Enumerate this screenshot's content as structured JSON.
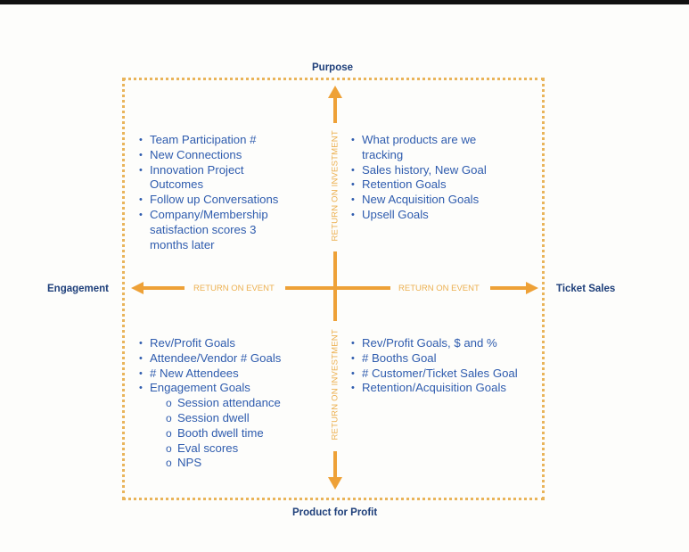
{
  "axes": {
    "top": "Purpose",
    "bottom": "Product for Profit",
    "left": "Engagement",
    "right": "Ticket Sales"
  },
  "arrow_labels": {
    "vertical_top": "RETURN ON INVESTMENT",
    "vertical_bottom": "RETURN ON INVESTMENT",
    "horizontal_left": "RETURN ON EVENT",
    "horizontal_right": "RETURN ON EVENT"
  },
  "colors": {
    "accent_orange": "#eea137",
    "text_blue": "#2f5cae",
    "title_navy": "#1e3f7a"
  },
  "quadrants": {
    "top_left": {
      "items": [
        {
          "text": "Team Participation #",
          "level": 1
        },
        {
          "text": "New Connections",
          "level": 1
        },
        {
          "text": "Innovation Project",
          "level": 1
        },
        {
          "text": "Outcomes",
          "level": 0
        },
        {
          "text": "Follow up Conversations",
          "level": 1
        },
        {
          "text": "Company/Membership",
          "level": 1
        },
        {
          "text": "satisfaction scores 3",
          "level": 0
        },
        {
          "text": "months later",
          "level": 0
        }
      ]
    },
    "top_right": {
      "items": [
        {
          "text": "What products are we",
          "level": 1
        },
        {
          "text": "tracking",
          "level": 0
        },
        {
          "text": "Sales history, New Goal",
          "level": 1
        },
        {
          "text": "Retention Goals",
          "level": 1
        },
        {
          "text": "New Acquisition Goals",
          "level": 1
        },
        {
          "text": "Upsell Goals",
          "level": 1
        }
      ]
    },
    "bottom_left": {
      "items": [
        {
          "text": "Rev/Profit Goals",
          "level": 1
        },
        {
          "text": "Attendee/Vendor # Goals",
          "level": 1
        },
        {
          "text": "# New Attendees",
          "level": 1
        },
        {
          "text": "Engagement Goals",
          "level": 1
        },
        {
          "text": "Session attendance",
          "level": 2
        },
        {
          "text": "Session dwell",
          "level": 2
        },
        {
          "text": "Booth dwell time",
          "level": 2
        },
        {
          "text": "Eval scores",
          "level": 2
        },
        {
          "text": "NPS",
          "level": 2
        }
      ]
    },
    "bottom_right": {
      "items": [
        {
          "text": "Rev/Profit Goals, $ and %",
          "level": 1
        },
        {
          "text": "# Booths Goal",
          "level": 1
        },
        {
          "text": "# Customer/Ticket Sales Goal",
          "level": 1
        },
        {
          "text": "Retention/Acquisition Goals",
          "level": 1
        }
      ]
    }
  }
}
